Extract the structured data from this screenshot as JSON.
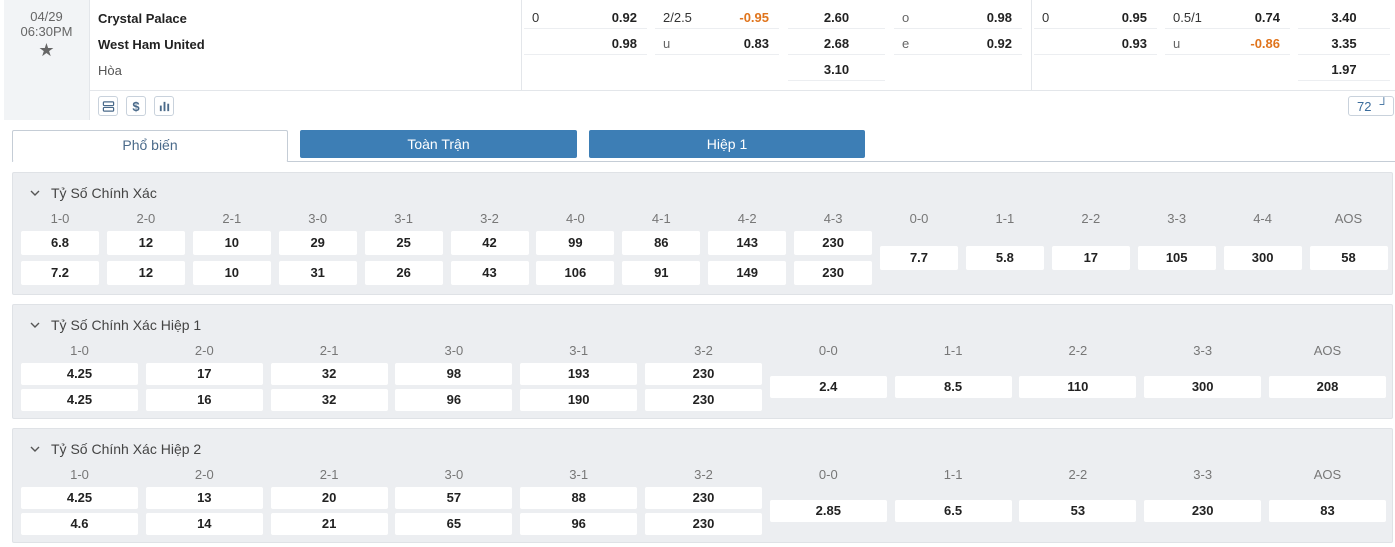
{
  "match": {
    "date": "04/29",
    "time": "06:30PM",
    "home": "Crystal Palace",
    "away": "West Ham United",
    "draw": "Hòa",
    "market_count": "72",
    "odds_rows": [
      [
        {
          "label": "0",
          "value": "0.92"
        },
        {
          "label": "2/2.5",
          "value": "-0.95"
        },
        {
          "label": "",
          "value": "2.60"
        },
        {
          "label": "o",
          "value": "0.98"
        },
        {
          "label": "0",
          "value": "0.95"
        },
        {
          "label": "0.5/1",
          "value": "0.74"
        },
        {
          "label": "",
          "value": "3.40"
        }
      ],
      [
        {
          "label": "",
          "value": "0.98"
        },
        {
          "label": "u",
          "value": "0.83"
        },
        {
          "label": "",
          "value": "2.68"
        },
        {
          "label": "e",
          "value": "0.92"
        },
        {
          "label": "",
          "value": "0.93"
        },
        {
          "label": "u",
          "value": "-0.86"
        },
        {
          "label": "",
          "value": "3.35"
        }
      ],
      [
        null,
        null,
        {
          "label": "",
          "value": "3.10"
        },
        null,
        null,
        null,
        {
          "label": "",
          "value": "1.97"
        }
      ]
    ],
    "tools": [
      {
        "name": "layout-icon"
      },
      {
        "name": "dollar-icon"
      },
      {
        "name": "bar-chart-icon"
      }
    ]
  },
  "tabs": [
    {
      "label": "Phổ biến",
      "active": true
    },
    {
      "label": "Toàn Trận",
      "active": false
    },
    {
      "label": "Hiệp 1",
      "active": false
    }
  ],
  "sections": [
    {
      "title": "Tỷ Số Chính Xác",
      "win_labels": [
        "1-0",
        "2-0",
        "2-1",
        "3-0",
        "3-1",
        "3-2",
        "4-0",
        "4-1",
        "4-2",
        "4-3"
      ],
      "home_odds": [
        "6.8",
        "12",
        "10",
        "29",
        "25",
        "42",
        "99",
        "86",
        "143",
        "230"
      ],
      "away_odds": [
        "7.2",
        "12",
        "10",
        "31",
        "26",
        "43",
        "106",
        "91",
        "149",
        "230"
      ],
      "draw_labels": [
        "0-0",
        "1-1",
        "2-2",
        "3-3",
        "4-4",
        "AOS"
      ],
      "draw_odds": [
        "7.7",
        "5.8",
        "17",
        "105",
        "300",
        "58"
      ]
    },
    {
      "title": "Tỷ Số Chính Xác Hiệp 1",
      "win_labels": [
        "1-0",
        "2-0",
        "2-1",
        "3-0",
        "3-1",
        "3-2"
      ],
      "home_odds": [
        "4.25",
        "17",
        "32",
        "98",
        "193",
        "230"
      ],
      "away_odds": [
        "4.25",
        "16",
        "32",
        "96",
        "190",
        "230"
      ],
      "draw_labels": [
        "0-0",
        "1-1",
        "2-2",
        "3-3",
        "AOS"
      ],
      "draw_odds": [
        "2.4",
        "8.5",
        "110",
        "300",
        "208"
      ]
    },
    {
      "title": "Tỷ Số Chính Xác Hiệp 2",
      "win_labels": [
        "1-0",
        "2-0",
        "2-1",
        "3-0",
        "3-1",
        "3-2"
      ],
      "home_odds": [
        "4.25",
        "13",
        "20",
        "57",
        "88",
        "230"
      ],
      "away_odds": [
        "4.6",
        "14",
        "21",
        "65",
        "96",
        "230"
      ],
      "draw_labels": [
        "0-0",
        "1-1",
        "2-2",
        "3-3",
        "AOS"
      ],
      "draw_odds": [
        "2.85",
        "6.5",
        "53",
        "230",
        "83"
      ]
    }
  ],
  "colors": {
    "tab_active_text": "#4a6a8a",
    "tab_inactive_bg": "#3d7eb5",
    "negative_odds": "#e0741c",
    "section_bg": "#eceef1"
  }
}
